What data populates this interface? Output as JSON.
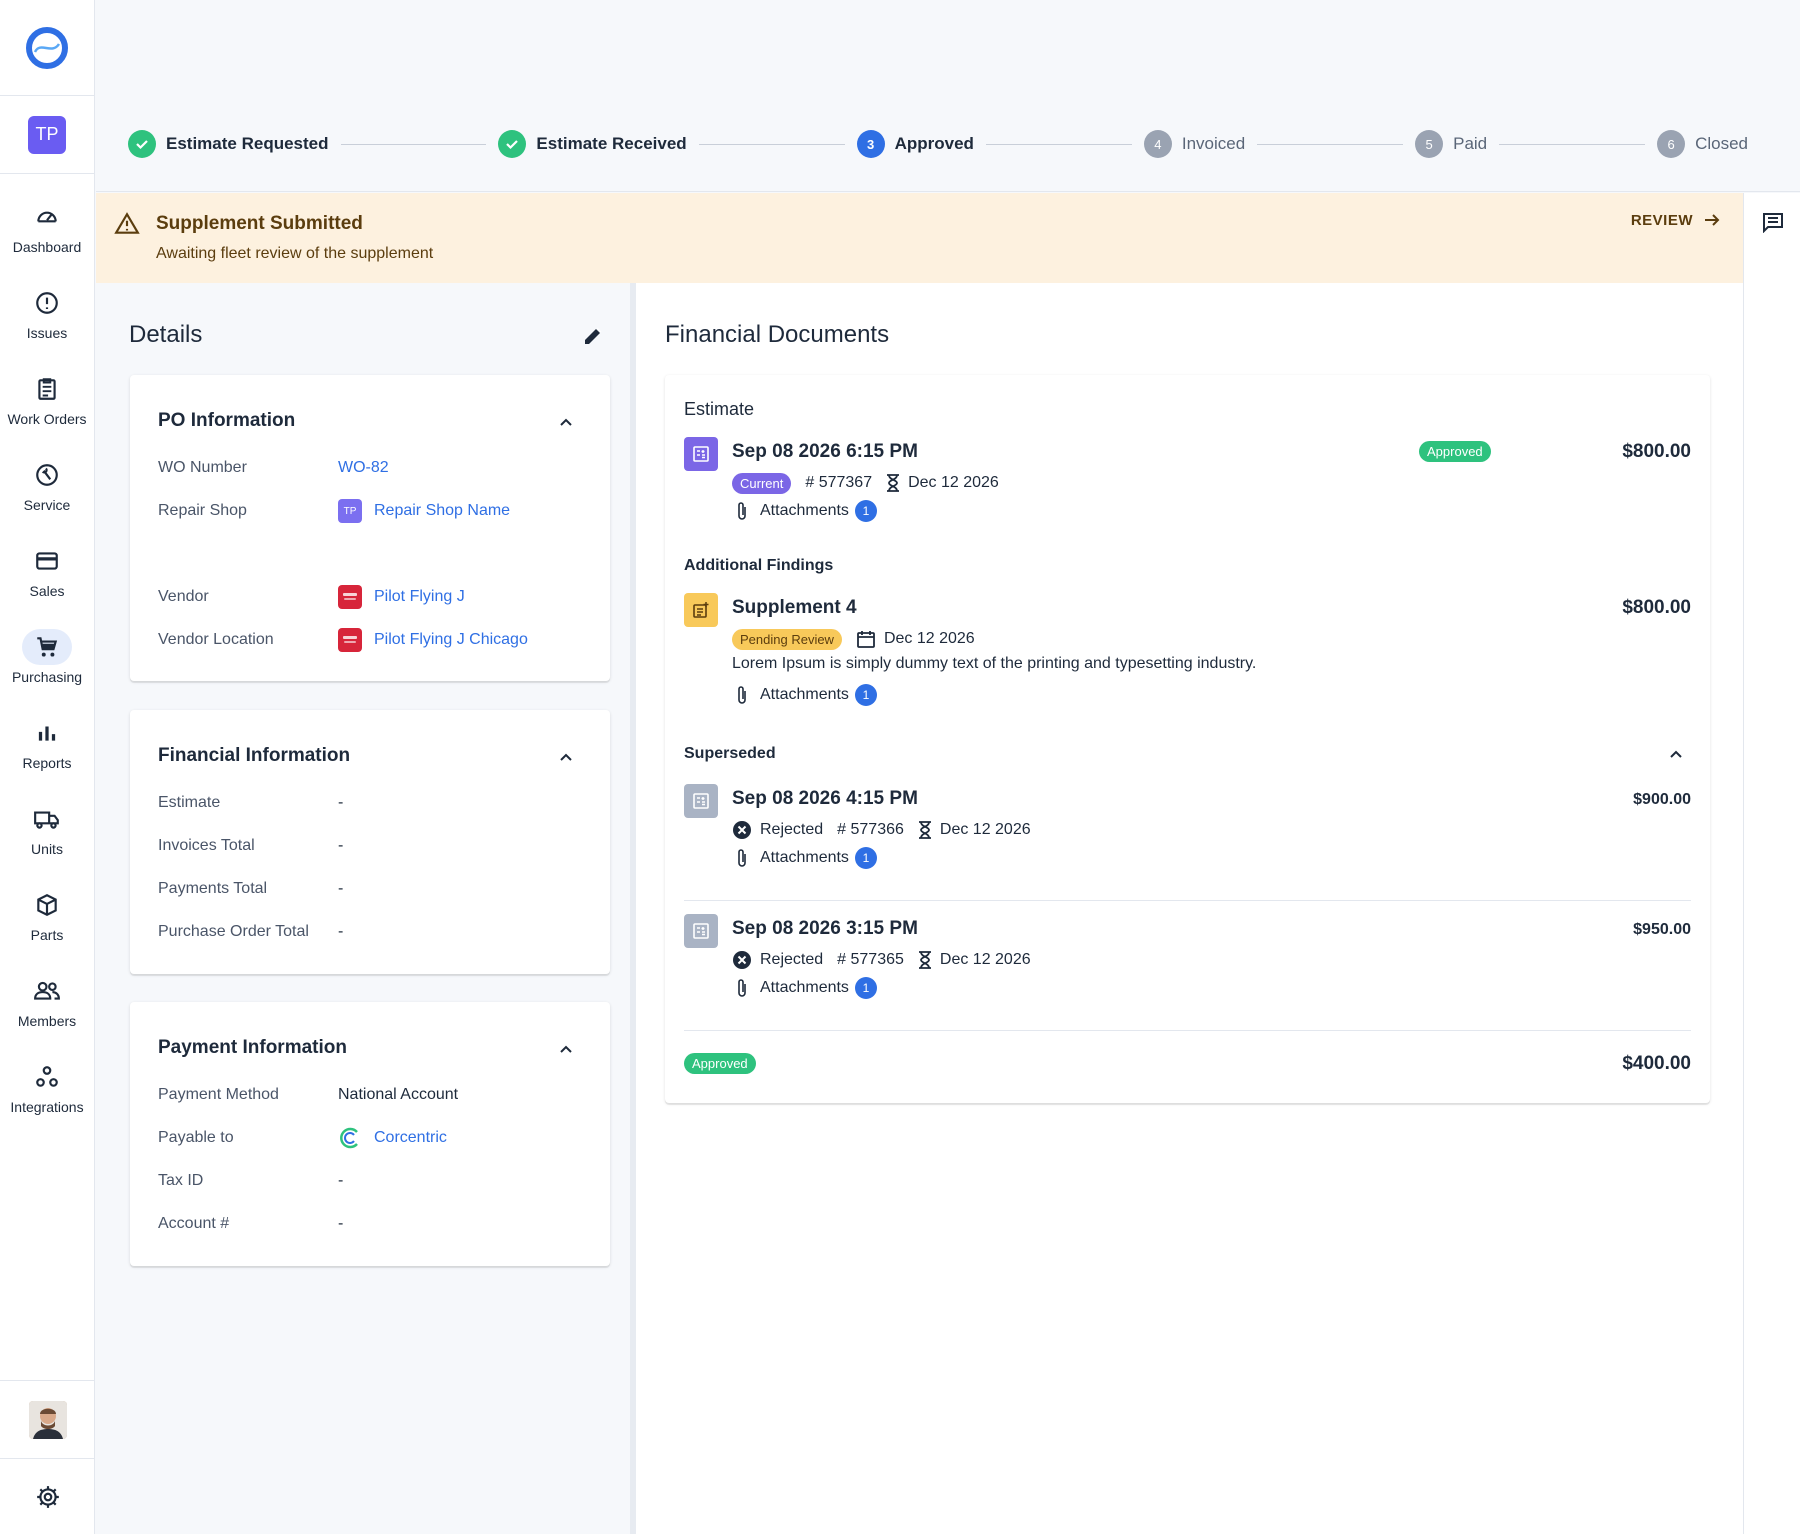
{
  "sidebar": {
    "org_initials": "TP",
    "items": [
      {
        "label": "Dashboard",
        "icon": "speedometer-icon"
      },
      {
        "label": "Issues",
        "icon": "alert-circle-icon"
      },
      {
        "label": "Work Orders",
        "icon": "clipboard-icon"
      },
      {
        "label": "Service",
        "icon": "wrench-icon"
      },
      {
        "label": "Sales",
        "icon": "credit-card-icon"
      },
      {
        "label": "Purchasing",
        "icon": "cart-icon",
        "active": true
      },
      {
        "label": "Reports",
        "icon": "bar-chart-icon"
      },
      {
        "label": "Units",
        "icon": "truck-icon"
      },
      {
        "label": "Parts",
        "icon": "box-icon"
      },
      {
        "label": "Members",
        "icon": "people-icon"
      },
      {
        "label": "Integrations",
        "icon": "integrations-icon"
      }
    ]
  },
  "stepper": {
    "steps": [
      {
        "label": "Estimate Requested",
        "status": "done"
      },
      {
        "label": "Estimate Received",
        "status": "done"
      },
      {
        "label": "Approved",
        "status": "current",
        "number": "3"
      },
      {
        "label": "Invoiced",
        "status": "todo",
        "number": "4"
      },
      {
        "label": "Paid",
        "status": "todo",
        "number": "5"
      },
      {
        "label": "Closed",
        "status": "todo",
        "number": "6"
      }
    ]
  },
  "alert": {
    "title": "Supplement Submitted",
    "message": "Awaiting fleet review of the supplement",
    "action": "REVIEW"
  },
  "details": {
    "title": "Details",
    "po": {
      "title": "PO Information",
      "wo_label": "WO Number",
      "wo_value": "WO-82",
      "shop_label": "Repair Shop",
      "shop_initials": "TP",
      "shop_value": "Repair Shop Name",
      "vendor_label": "Vendor",
      "vendor_value": "Pilot Flying J",
      "location_label": "Vendor Location",
      "location_value": "Pilot Flying J Chicago"
    },
    "financial": {
      "title": "Financial Information",
      "rows": [
        {
          "label": "Estimate",
          "value": "-"
        },
        {
          "label": "Invoices Total",
          "value": "-"
        },
        {
          "label": "Payments Total",
          "value": "-"
        },
        {
          "label": "Purchase Order Total",
          "value": "-"
        }
      ]
    },
    "payment": {
      "title": "Payment Information",
      "method_label": "Payment Method",
      "method_value": "National Account",
      "payable_label": "Payable to",
      "payable_value": "Corcentric",
      "tax_label": "Tax ID",
      "tax_value": "-",
      "account_label": "Account #",
      "account_value": "-"
    }
  },
  "financial_documents": {
    "title": "Financial Documents",
    "estimate_section": "Estimate",
    "current": {
      "datetime": "Sep 08 2026 6:15 PM",
      "tag": "Current",
      "number": "# 577367",
      "expires": "Dec 12 2026",
      "attachments_label": "Attachments",
      "attachments_count": "1",
      "status": "Approved",
      "amount": "$800.00"
    },
    "additional_section": "Additional Findings",
    "supplement": {
      "title": "Supplement 4",
      "status": "Pending Review",
      "date": "Dec 12 2026",
      "description": "Lorem Ipsum is simply dummy text of the printing and typesetting industry.",
      "attachments_label": "Attachments",
      "attachments_count": "1",
      "amount": "$800.00"
    },
    "superseded_section": "Superseded",
    "superseded": [
      {
        "datetime": "Sep 08 2026 4:15 PM",
        "status": "Rejected",
        "number": "# 577366",
        "expires": "Dec 12 2026",
        "attachments_label": "Attachments",
        "attachments_count": "1",
        "amount": "$900.00"
      },
      {
        "datetime": "Sep 08 2026 3:15 PM",
        "status": "Rejected",
        "number": "# 577365",
        "expires": "Dec 12 2026",
        "attachments_label": "Attachments",
        "attachments_count": "1",
        "amount": "$950.00"
      }
    ],
    "footer": {
      "status": "Approved",
      "amount": "$400.00"
    }
  }
}
